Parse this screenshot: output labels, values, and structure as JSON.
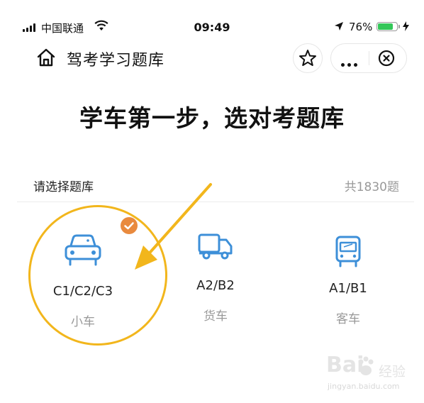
{
  "status_bar": {
    "carrier": "中国联通",
    "time": "09:49",
    "battery_percent": "76%",
    "battery_level": 0.76
  },
  "nav": {
    "title": "驾考学习题库",
    "home_icon": "home-icon",
    "star_icon": "star-icon",
    "more_icon": "more-dots-icon",
    "close_icon": "close-circle-icon"
  },
  "headline": "学车第一步，选对考题库",
  "section": {
    "label": "请选择题库",
    "count": "共1830题"
  },
  "options": [
    {
      "code": "C1/C2/C3",
      "kind": "小车",
      "icon": "car-icon",
      "selected": true
    },
    {
      "code": "A2/B2",
      "kind": "货车",
      "icon": "truck-icon",
      "selected": false
    },
    {
      "code": "A1/B1",
      "kind": "客车",
      "icon": "bus-icon",
      "selected": false
    }
  ],
  "colors": {
    "icon_blue": "#3d8fd8",
    "check_orange": "#e98a3e",
    "annotation_yellow": "#f2b61c",
    "muted_text": "#999999"
  },
  "watermark": {
    "brand": "Bai",
    "brand_cn": "经验",
    "url": "jingyan.baidu.com"
  }
}
